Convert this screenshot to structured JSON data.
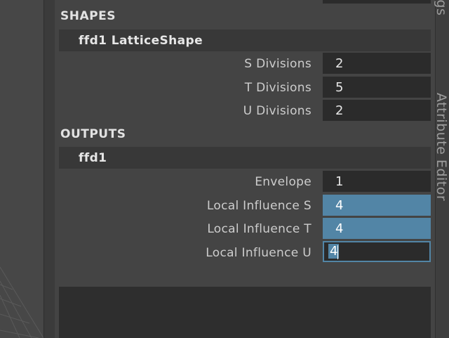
{
  "side_tabs": [
    "Tool Settings",
    "Attribute Editor"
  ],
  "sections": [
    {
      "header": "SHAPES",
      "node": "ffd1 LatticeShape",
      "attributes": [
        {
          "label": "S Divisions",
          "value": "2"
        },
        {
          "label": "T Divisions",
          "value": "5"
        },
        {
          "label": "U Divisions",
          "value": "2"
        }
      ]
    },
    {
      "header": "OUTPUTS",
      "node": "ffd1",
      "attributes": [
        {
          "label": "Envelope",
          "value": "1"
        },
        {
          "label": "Local Influence S",
          "value": "4",
          "state": "selected"
        },
        {
          "label": "Local Influence T",
          "value": "4",
          "state": "selected"
        },
        {
          "label": "Local Influence U",
          "value": "4",
          "state": "editing"
        }
      ]
    }
  ]
}
